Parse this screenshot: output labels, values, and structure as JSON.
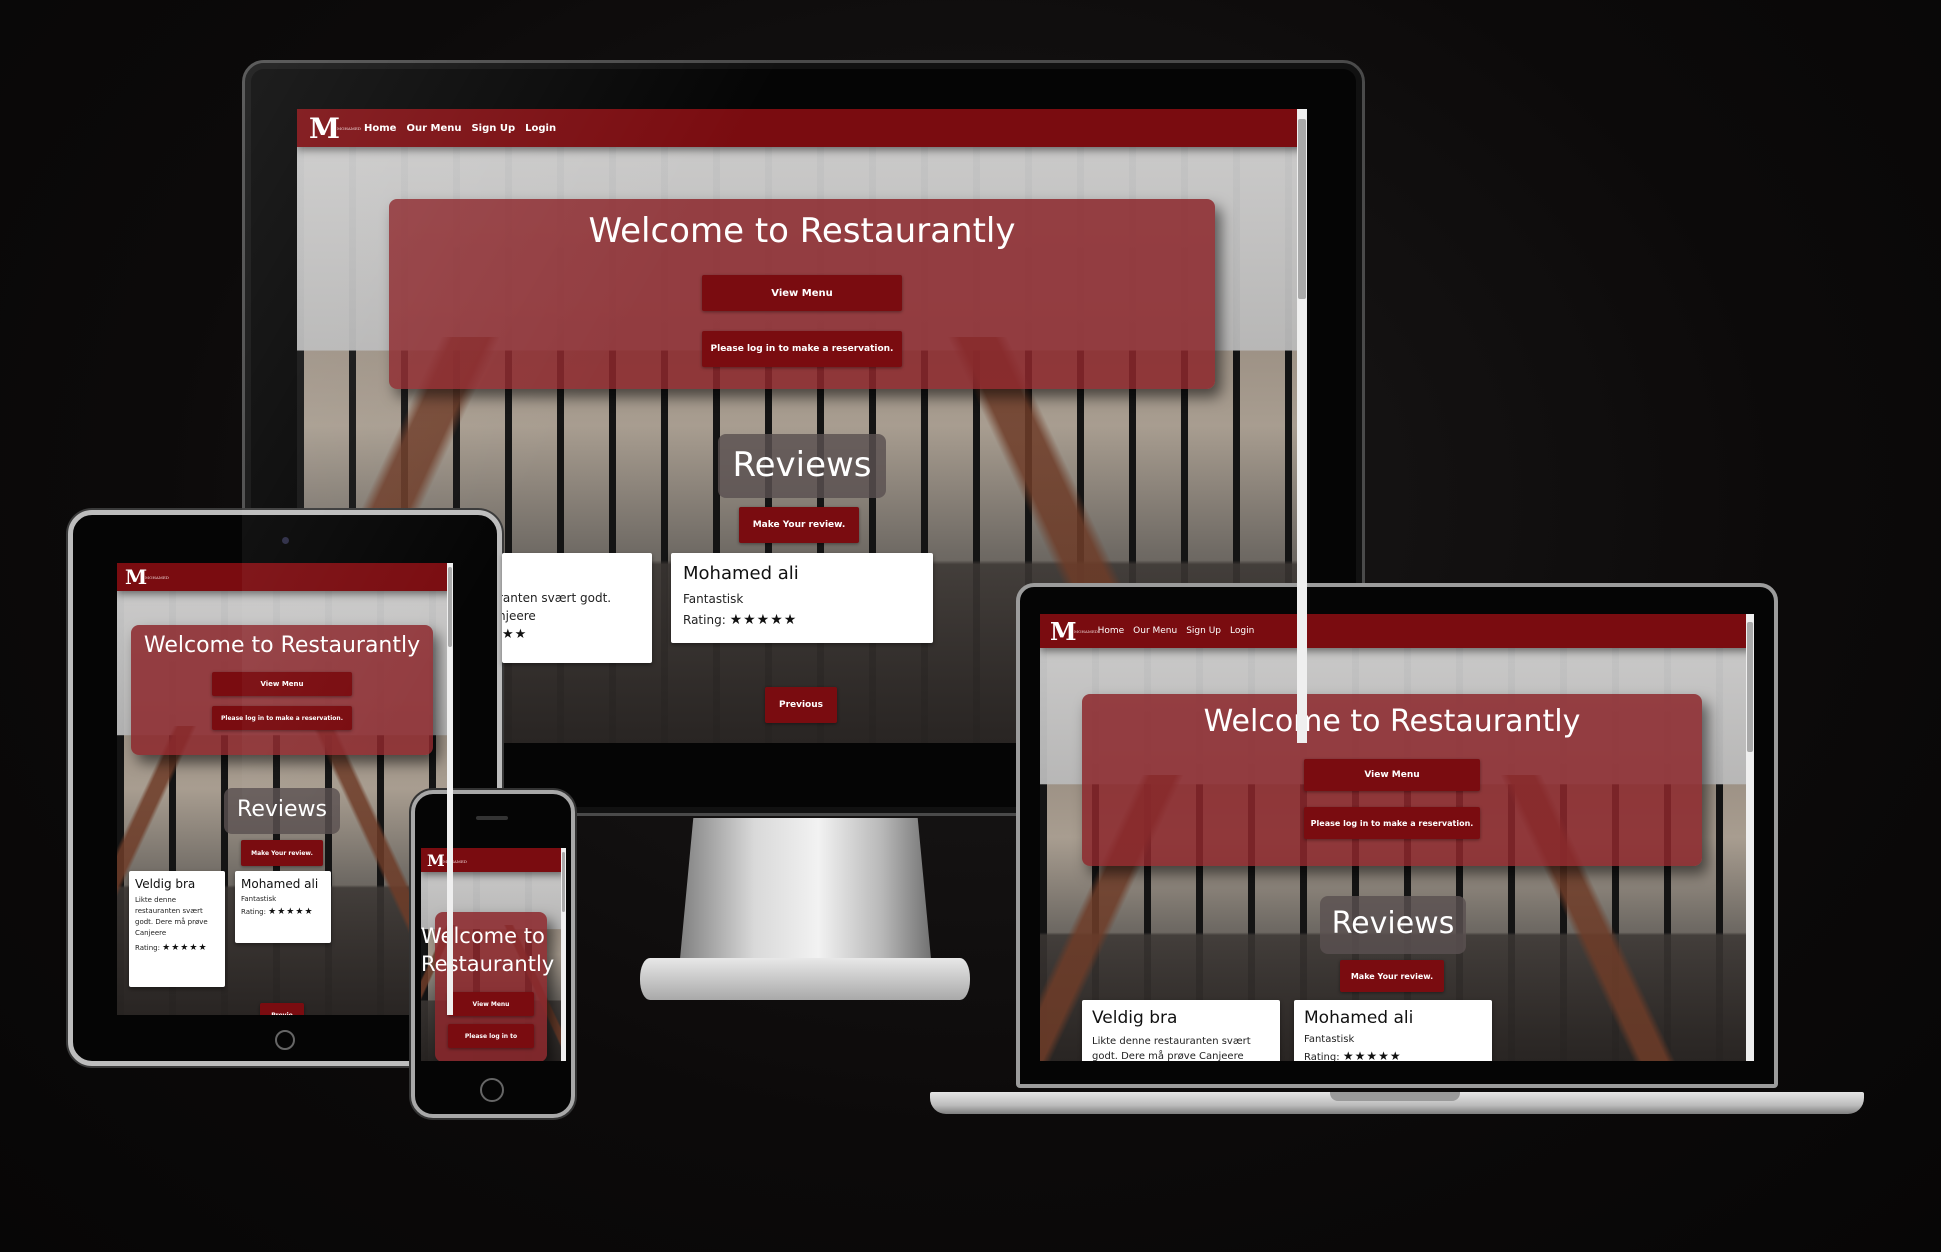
{
  "site": {
    "logo": "M",
    "logo_small": "MOHAMED",
    "nav": [
      "Home",
      "Our Menu",
      "Sign Up",
      "Login"
    ],
    "hero_title": "Welcome to Restaurantly",
    "phone_hero_title_1": "Welcome to",
    "phone_hero_title_2": "Restaurantly",
    "view_menu": "View Menu",
    "login_prompt": "Please log in to make a reservation.",
    "laptop_login_prompt": "Please log in to make a reservation.",
    "phone_login_prompt": "Please log in to",
    "reviews_title": "Reviews",
    "make_review": "Make Your review.",
    "previous": "Previous",
    "previous_cut": "Previo",
    "rating_label": "Rating:"
  },
  "reviews": [
    {
      "title": "Veldig bra",
      "text": "Likte denne restauranten svært godt. Dere må prøve Canjeere",
      "monitor_fragment_1": "ranten svært godt.",
      "monitor_fragment_2": "njeere",
      "stars": "★★★★★",
      "monitor_stars": "★★"
    },
    {
      "title": "Mohamed ali",
      "text": "Fantastisk",
      "stars": "★★★★★"
    }
  ],
  "colors": {
    "nav": "#7a0c10",
    "hero": "rgba(140,40,44,.86)",
    "button": "#7a0c10",
    "reviews_badge": "rgba(90,80,80,.82)"
  }
}
